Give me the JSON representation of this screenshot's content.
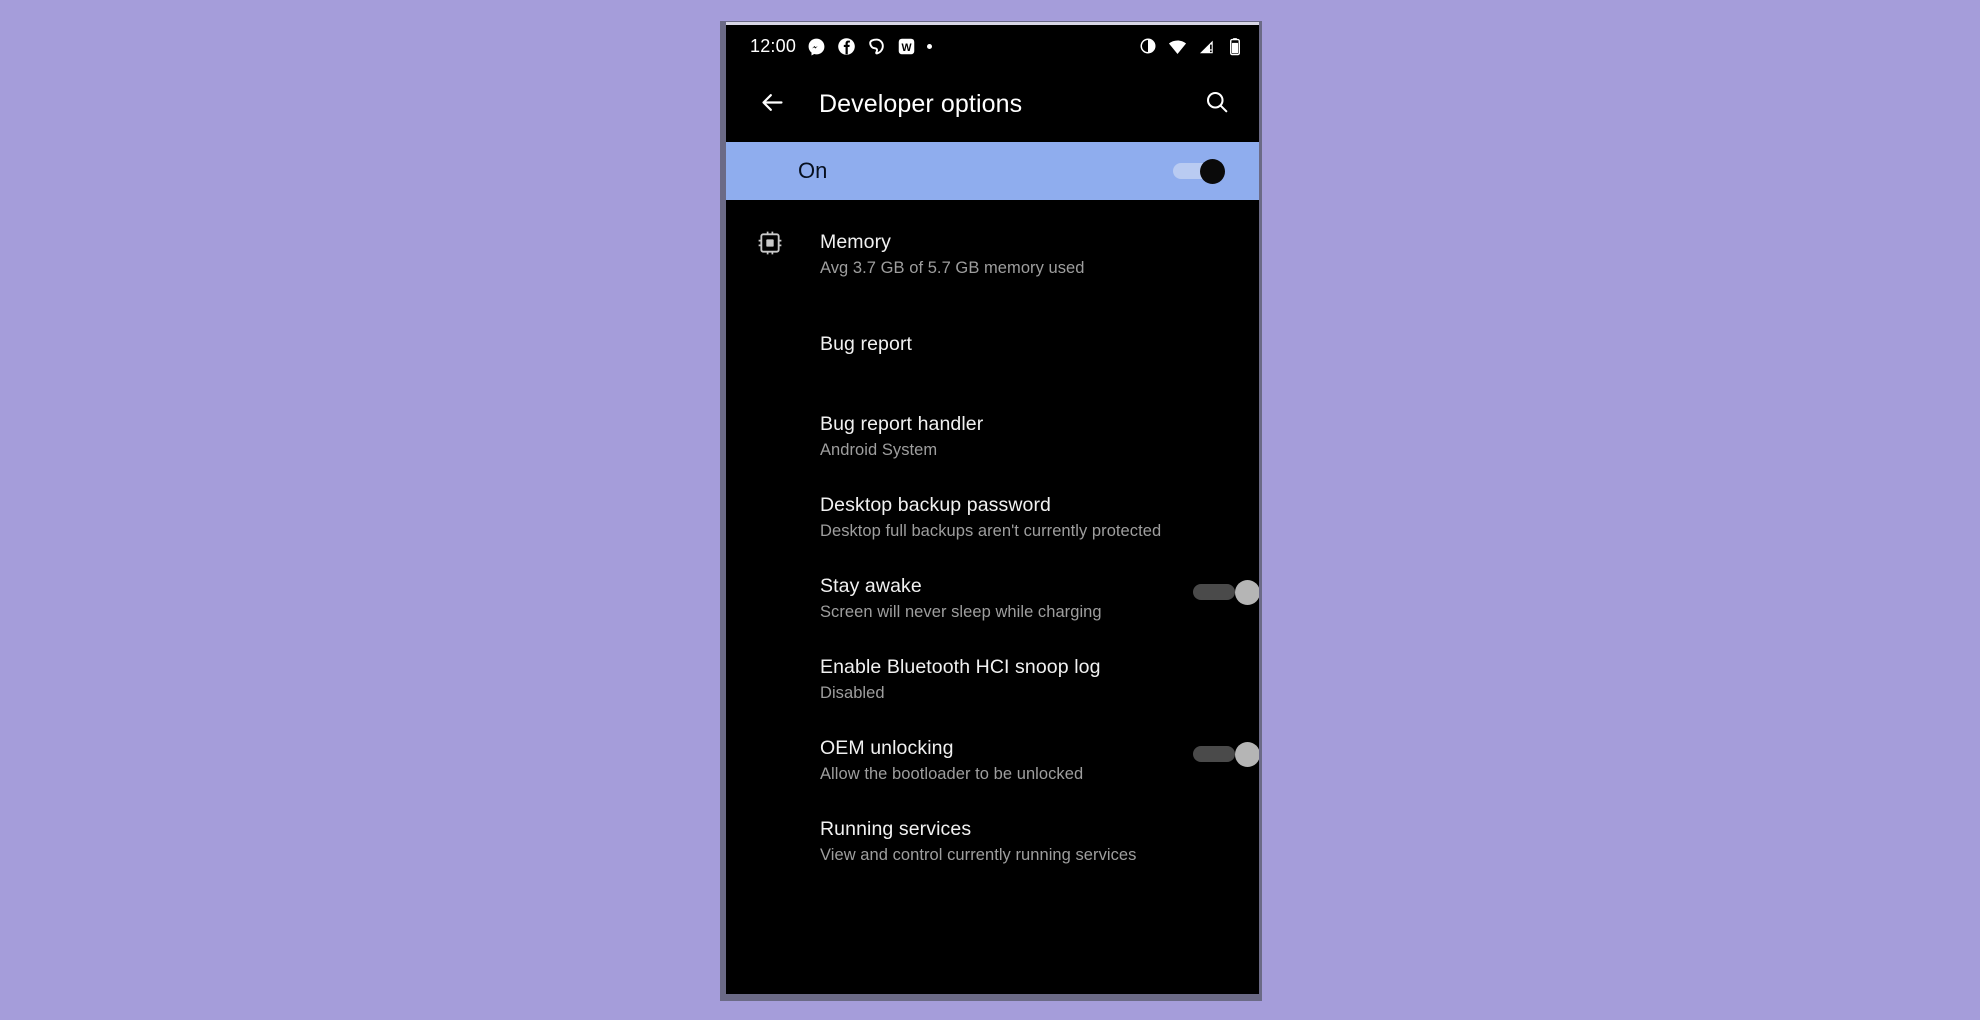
{
  "background_color": "#a59dda",
  "status_bar": {
    "time": "12:00",
    "left_icons": [
      {
        "name": "messenger-icon"
      },
      {
        "name": "facebook-icon"
      },
      {
        "name": "ring-notification-icon"
      },
      {
        "name": "w-app-icon",
        "glyph": "W"
      },
      {
        "name": "more-notifications-dot-icon"
      }
    ],
    "right_icons": [
      {
        "name": "dark-theme-contrast-icon"
      },
      {
        "name": "wifi-icon"
      },
      {
        "name": "cellular-signal-alert-icon"
      },
      {
        "name": "battery-icon"
      }
    ]
  },
  "app_bar": {
    "back_label": "Back",
    "title": "Developer options",
    "search_label": "Search",
    "back_icon": "arrow-back-icon",
    "search_icon": "search-icon"
  },
  "master_switch": {
    "label": "On",
    "state": "on",
    "row_color": "#8fadee",
    "label_color": "#07101f",
    "thumb_color": "#0a0a0a",
    "track_color": "#b9cbf2"
  },
  "settings": {
    "items": [
      {
        "title": "Memory",
        "summary": "Avg 3.7 GB of 5.7 GB memory used",
        "icon": "memory-chip-icon",
        "has_icon": true,
        "toggle": null
      },
      {
        "title": "Bug report",
        "summary": "",
        "icon": "",
        "has_icon": false,
        "toggle": null
      },
      {
        "title": "Bug report handler",
        "summary": "Android System",
        "icon": "",
        "has_icon": false,
        "toggle": null
      },
      {
        "title": "Desktop backup password",
        "summary": "Desktop full backups aren't currently protected",
        "icon": "",
        "has_icon": false,
        "toggle": null
      },
      {
        "title": "Stay awake",
        "summary": "Screen will never sleep while charging",
        "icon": "",
        "has_icon": false,
        "toggle": "off"
      },
      {
        "title": "Enable Bluetooth HCI snoop log",
        "summary": "Disabled",
        "icon": "",
        "has_icon": false,
        "toggle": null
      },
      {
        "title": "OEM unlocking",
        "summary": "Allow the bootloader to be unlocked",
        "icon": "",
        "has_icon": false,
        "toggle": "off"
      },
      {
        "title": "Running services",
        "summary": "View and control currently running services",
        "icon": "",
        "has_icon": false,
        "toggle": null
      }
    ]
  }
}
